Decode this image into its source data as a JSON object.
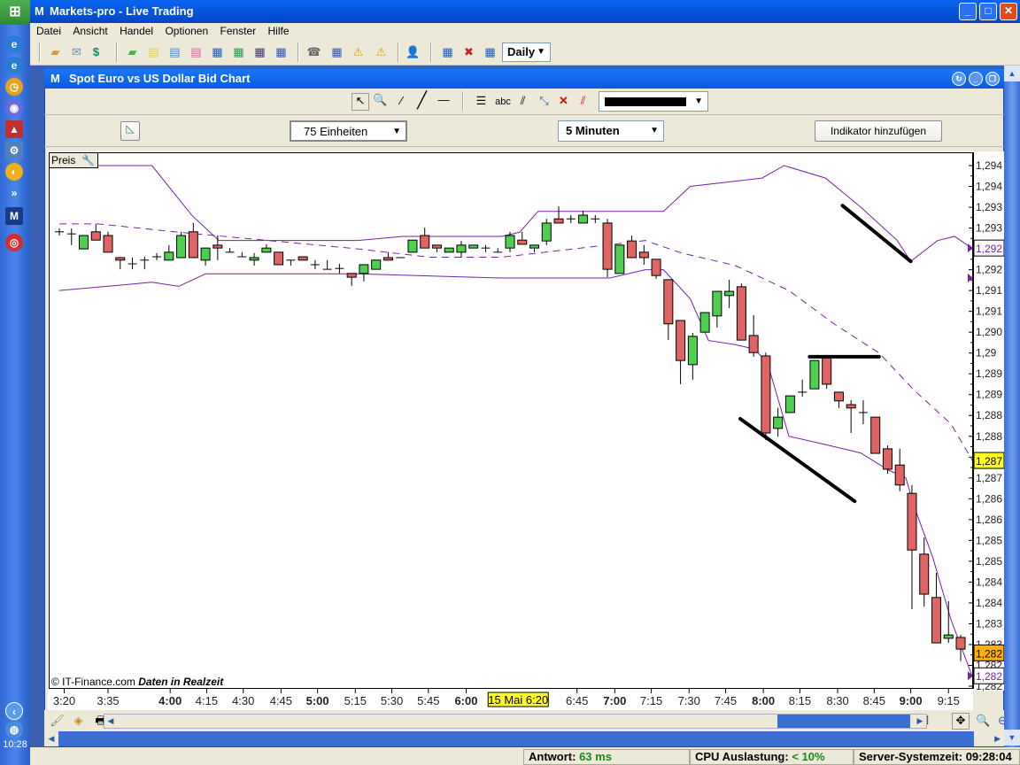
{
  "app": {
    "title": "Markets-pro - Live Trading",
    "logo": "M"
  },
  "menu": [
    "Datei",
    "Ansicht",
    "Handel",
    "Optionen",
    "Fenster",
    "Hilfe"
  ],
  "toolbar": {
    "icons": [
      "open-folder-icon",
      "mail-icon",
      "dollar-icon",
      "green-folder-icon",
      "yellow-note-icon",
      "blue-list-icon",
      "pink-list-icon",
      "chart-window-icon",
      "chart-window-green-icon",
      "chart-window-dark-icon",
      "chart-dollar-icon",
      "telephone-icon",
      "calculator-icon",
      "warning-icon",
      "warning-tool-icon",
      "user-icon",
      "layout-open-icon",
      "layout-delete-icon",
      "layout-save-icon"
    ],
    "period_select": "Daily"
  },
  "taskbar": {
    "clock": "10:28"
  },
  "chart_window": {
    "title": "Spot Euro vs US Dollar Bid Chart",
    "units_select": "75 Einheiten",
    "interval_select": "5 Minuten",
    "add_indicator": "Indikator hinzufügen",
    "abc_tool": "abc",
    "preis_label": "Preis",
    "copyright": "© IT-Finance.com",
    "realtime": "Daten in Realzeit"
  },
  "status": {
    "antwort_label": "Antwort:",
    "antwort_value": "63 ms",
    "cpu_label": "CPU Auslastung:",
    "cpu_value": "< 10%",
    "server_label": "Server-Systemzeit:",
    "server_value": "09:28:04"
  },
  "colors": {
    "up": "#4fcf4f",
    "down": "#e06464",
    "band": "#7a1fa8",
    "accent": "#0a5ae0"
  },
  "chart_data": {
    "type": "candlestick",
    "title": "Spot Euro vs US Dollar Bid Chart",
    "ylim": [
      1.282,
      1.2945
    ],
    "candles": [
      [
        1.29291,
        1.29299,
        1.29282,
        1.29291
      ],
      [
        1.29286,
        1.29299,
        1.29259,
        1.29286
      ],
      [
        1.2925,
        1.29282,
        1.2925,
        1.29282
      ],
      [
        1.29291,
        1.2931,
        1.29271,
        1.29271
      ],
      [
        1.29282,
        1.29291,
        1.29242,
        1.29242
      ],
      [
        1.29229,
        1.29229,
        1.29201,
        1.29223
      ],
      [
        1.29214,
        1.29229,
        1.29201,
        1.29214
      ],
      [
        1.29223,
        1.29231,
        1.29201,
        1.29223
      ],
      [
        1.29231,
        1.2924,
        1.29223,
        1.29231
      ],
      [
        1.29223,
        1.29259,
        1.29223,
        1.29242
      ],
      [
        1.29229,
        1.29291,
        1.29229,
        1.29282
      ],
      [
        1.29291,
        1.29312,
        1.29229,
        1.29229
      ],
      [
        1.29223,
        1.29252,
        1.2921,
        1.29252
      ],
      [
        1.29259,
        1.29282,
        1.29223,
        1.29252
      ],
      [
        1.29242,
        1.29252,
        1.29242,
        1.29242
      ],
      [
        1.29231,
        1.29242,
        1.29231,
        1.29231
      ],
      [
        1.29223,
        1.2924,
        1.2921,
        1.29229
      ],
      [
        1.29242,
        1.29261,
        1.29242,
        1.29252
      ],
      [
        1.29242,
        1.29242,
        1.29212,
        1.29212
      ],
      [
        1.29223,
        1.29223,
        1.2921,
        1.29223
      ],
      [
        1.29231,
        1.29231,
        1.29223,
        1.29223
      ],
      [
        1.29212,
        1.29223,
        1.29201,
        1.29212
      ],
      [
        1.29201,
        1.29223,
        1.29201,
        1.29201
      ],
      [
        1.29203,
        1.29214,
        1.29191,
        1.29203
      ],
      [
        1.29191,
        1.29191,
        1.29161,
        1.29182
      ],
      [
        1.29191,
        1.29212,
        1.29172,
        1.29212
      ],
      [
        1.29201,
        1.29223,
        1.29201,
        1.29223
      ],
      [
        1.29229,
        1.29242,
        1.29223,
        1.29223
      ],
      [
        1.29229,
        1.29229,
        1.29229,
        1.29229
      ],
      [
        1.29242,
        1.29271,
        1.29242,
        1.29271
      ],
      [
        1.29282,
        1.29301,
        1.29252,
        1.29252
      ],
      [
        1.29259,
        1.29259,
        1.29242,
        1.29252
      ],
      [
        1.29242,
        1.29252,
        1.29242,
        1.29252
      ],
      [
        1.29242,
        1.29269,
        1.29229,
        1.29259
      ],
      [
        1.29252,
        1.29259,
        1.29252,
        1.29259
      ],
      [
        1.29252,
        1.29259,
        1.29242,
        1.29252
      ],
      [
        1.29242,
        1.29252,
        1.29242,
        1.29242
      ],
      [
        1.29252,
        1.29291,
        1.29242,
        1.29282
      ],
      [
        1.29271,
        1.29291,
        1.29261,
        1.29261
      ],
      [
        1.29252,
        1.29259,
        1.29242,
        1.29259
      ],
      [
        1.29269,
        1.29322,
        1.29259,
        1.29312
      ],
      [
        1.29322,
        1.29352,
        1.29312,
        1.29312
      ],
      [
        1.29322,
        1.29331,
        1.29312,
        1.29322
      ],
      [
        1.29312,
        1.29342,
        1.29312,
        1.29331
      ],
      [
        1.29322,
        1.29331,
        1.29312,
        1.29322
      ],
      [
        1.29312,
        1.29322,
        1.29182,
        1.29201
      ],
      [
        1.29191,
        1.29259,
        1.29191,
        1.29259
      ],
      [
        1.29269,
        1.29282,
        1.29229,
        1.29229
      ],
      [
        1.29242,
        1.29259,
        1.29212,
        1.29229
      ],
      [
        1.29225,
        1.29225,
        1.29178,
        1.29186
      ],
      [
        1.29176,
        1.29176,
        1.29031,
        1.2907
      ],
      [
        1.29078,
        1.29078,
        1.28925,
        1.28982
      ],
      [
        1.28972,
        1.29048,
        1.28936,
        1.2904
      ],
      [
        1.2905,
        1.29097,
        1.2905,
        1.29097
      ],
      [
        1.29089,
        1.29148,
        1.29061,
        1.29148
      ],
      [
        1.29138,
        1.29176,
        1.29108,
        1.29148
      ],
      [
        1.29159,
        1.29167,
        1.29031,
        1.29031
      ],
      [
        1.29042,
        1.29091,
        1.28991,
        1.29001
      ],
      [
        1.28993,
        1.29001,
        1.28791,
        1.28808
      ],
      [
        1.28819,
        1.28868,
        1.28799,
        1.28846
      ],
      [
        1.28857,
        1.28897,
        1.28857,
        1.28897
      ],
      [
        1.28906,
        1.28936,
        1.28895,
        1.28906
      ],
      [
        1.28914,
        1.28982,
        1.28914,
        1.28982
      ],
      [
        1.28993,
        1.28993,
        1.28914,
        1.28925
      ],
      [
        1.28906,
        1.28906,
        1.28868,
        1.28885
      ],
      [
        1.28876,
        1.28887,
        1.28808,
        1.28868
      ],
      [
        1.28857,
        1.28887,
        1.28829,
        1.28857
      ],
      [
        1.28846,
        1.28846,
        1.28759,
        1.28759
      ],
      [
        1.2877,
        1.28778,
        1.2871,
        1.28721
      ],
      [
        1.28731,
        1.2877,
        1.28668,
        1.28683
      ],
      [
        1.28663,
        1.28683,
        1.28385,
        1.28527
      ],
      [
        1.28517,
        1.28557,
        1.28391,
        1.28421
      ],
      [
        1.28413,
        1.28472,
        1.28304,
        1.28304
      ],
      [
        1.28315,
        1.28404,
        1.28304,
        1.28323
      ],
      [
        1.28317,
        1.28323,
        1.2826,
        1.28289
      ]
    ],
    "bollinger": {
      "upper": [
        [
          0,
          1.2945
        ],
        [
          7.6,
          1.2945
        ],
        [
          10.9,
          1.2933
        ],
        [
          13.1,
          1.2927
        ],
        [
          24.5,
          1.2927
        ],
        [
          28.2,
          1.2928
        ],
        [
          36.3,
          1.2928
        ],
        [
          37.8,
          1.2929
        ],
        [
          39.3,
          1.2934
        ],
        [
          49.6,
          1.2934
        ],
        [
          51.8,
          1.294
        ],
        [
          57.7,
          1.2942
        ],
        [
          59.5,
          1.2945
        ],
        [
          62.9,
          1.2942
        ],
        [
          65.8,
          1.2935
        ],
        [
          68.8,
          1.2927
        ],
        [
          69.9,
          1.2922
        ],
        [
          72.1,
          1.2927
        ],
        [
          73.5,
          1.2928
        ],
        [
          75,
          1.2925
        ]
      ],
      "middle": [
        [
          0,
          1.2931
        ],
        [
          3.2,
          1.2931
        ],
        [
          9.8,
          1.2929
        ],
        [
          17.2,
          1.2927
        ],
        [
          24.5,
          1.2925
        ],
        [
          30.4,
          1.2923
        ],
        [
          36.3,
          1.2923
        ],
        [
          39.3,
          1.2924
        ],
        [
          45.2,
          1.2926
        ],
        [
          48.1,
          1.2927
        ],
        [
          51.1,
          1.2924
        ],
        [
          55.5,
          1.2921
        ],
        [
          59.9,
          1.2915
        ],
        [
          63.6,
          1.2907
        ],
        [
          67.3,
          1.29
        ],
        [
          70.2,
          1.2891
        ],
        [
          73.2,
          1.2883
        ],
        [
          75,
          1.2874
        ]
      ],
      "lower": [
        [
          0,
          1.2915
        ],
        [
          3.9,
          1.2916
        ],
        [
          7.6,
          1.2917
        ],
        [
          9.8,
          1.2916
        ],
        [
          12,
          1.2919
        ],
        [
          24.5,
          1.2919
        ],
        [
          36.3,
          1.2918
        ],
        [
          39.3,
          1.2918
        ],
        [
          45.2,
          1.2918
        ],
        [
          48.1,
          1.292
        ],
        [
          49.6,
          1.292
        ],
        [
          51.8,
          1.2913
        ],
        [
          53.3,
          1.2903
        ],
        [
          55.5,
          1.2902
        ],
        [
          57,
          1.2901
        ],
        [
          58.1,
          1.2898
        ],
        [
          59.9,
          1.288
        ],
        [
          62.9,
          1.2878
        ],
        [
          65.8,
          1.2876
        ],
        [
          68,
          1.2872
        ],
        [
          69.5,
          1.287
        ],
        [
          70.2,
          1.2863
        ],
        [
          71.7,
          1.2851
        ],
        [
          73.2,
          1.2836
        ],
        [
          75,
          1.2822
        ]
      ]
    },
    "trendlines": [
      [
        [
          64.3,
          1.29354
        ],
        [
          69.9,
          1.2922
        ]
      ],
      [
        [
          61.6,
          1.28991
        ],
        [
          67.3,
          1.28991
        ]
      ],
      [
        [
          55.9,
          1.28842
        ],
        [
          65.3,
          1.28644
        ]
      ]
    ],
    "y_ticks": [
      [
        1.2945,
        "1,294"
      ],
      [
        1.294,
        "1,294"
      ],
      [
        1.2935,
        "1,293"
      ],
      [
        1.293,
        "1,293"
      ],
      [
        1.2925,
        "1,292"
      ],
      [
        1.292,
        "1,292"
      ],
      [
        1.2915,
        "1,291"
      ],
      [
        1.291,
        "1,291"
      ],
      [
        1.2905,
        "1,290"
      ],
      [
        1.29,
        "1,29"
      ],
      [
        1.2895,
        "1,289"
      ],
      [
        1.289,
        "1,289"
      ],
      [
        1.2885,
        "1,288"
      ],
      [
        1.288,
        "1,288"
      ],
      [
        1.2875,
        "1,287"
      ],
      [
        1.287,
        "1,287"
      ],
      [
        1.2865,
        "1,286"
      ],
      [
        1.286,
        "1,286"
      ],
      [
        1.2855,
        "1,285"
      ],
      [
        1.285,
        "1,285"
      ],
      [
        1.2845,
        "1,284"
      ],
      [
        1.284,
        "1,284"
      ],
      [
        1.2835,
        "1,283"
      ],
      [
        1.283,
        "1,283"
      ],
      [
        1.2825,
        "1,282"
      ],
      [
        1.282,
        "1,282"
      ]
    ],
    "price_markers": [
      {
        "value": 1.29252,
        "label": "1,292",
        "kind": "band"
      },
      {
        "value": 1.28742,
        "label": "1,287",
        "kind": "middle"
      },
      {
        "value": 1.2828,
        "label": "1,282",
        "kind": "last"
      },
      {
        "value": 1.28225,
        "label": "1,282",
        "kind": "band"
      }
    ],
    "x_ticks": [
      [
        0.4,
        "3:20",
        false
      ],
      [
        4,
        "3:35",
        false
      ],
      [
        9.1,
        "4:00",
        true
      ],
      [
        12.1,
        "4:15",
        false
      ],
      [
        15.1,
        "4:30",
        false
      ],
      [
        18.2,
        "4:45",
        false
      ],
      [
        21.2,
        "5:00",
        true
      ],
      [
        24.3,
        "5:15",
        false
      ],
      [
        27.3,
        "5:30",
        false
      ],
      [
        30.3,
        "5:45",
        false
      ],
      [
        33.4,
        "6:00",
        true
      ],
      [
        42.5,
        "6:45",
        false
      ],
      [
        45.6,
        "7:00",
        true
      ],
      [
        48.6,
        "7:15",
        false
      ],
      [
        51.7,
        "7:30",
        false
      ],
      [
        54.7,
        "7:45",
        false
      ],
      [
        57.8,
        "8:00",
        true
      ],
      [
        60.8,
        "8:15",
        false
      ],
      [
        63.9,
        "8:30",
        false
      ],
      [
        66.9,
        "8:45",
        false
      ],
      [
        69.9,
        "9:00",
        true
      ],
      [
        73,
        "9:15",
        false
      ]
    ],
    "cursor_time": {
      "index": 37.6,
      "label": "15 Mai 6:20"
    }
  }
}
